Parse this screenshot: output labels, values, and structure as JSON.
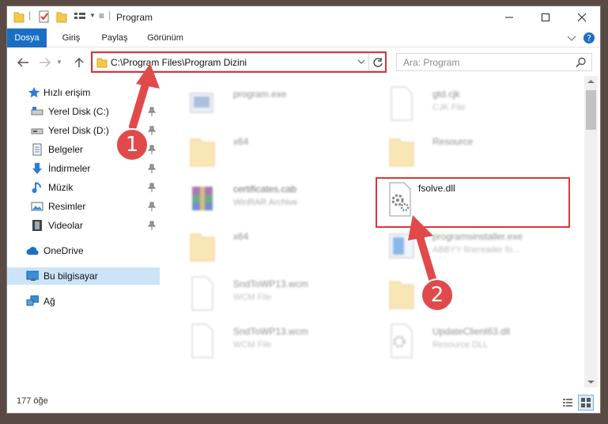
{
  "window": {
    "title": "Program"
  },
  "ribbon": {
    "tabs": [
      "Dosya",
      "Giriş",
      "Paylaş",
      "Görünüm"
    ]
  },
  "address": {
    "path": "C:\\Program Files\\Program Dizini"
  },
  "search": {
    "placeholder": "Ara: Program"
  },
  "sidebar": {
    "quick_access": "Hızlı erişim",
    "items": [
      "Yerel Disk (C:)",
      "Yerel Disk (D:)",
      "Belgeler",
      "İndirmeler",
      "Müzik",
      "Resimler",
      "Videolar"
    ],
    "onedrive": "OneDrive",
    "this_pc": "Bu bilgisayar",
    "network": "Ağ"
  },
  "files": [
    {
      "name": "program.exe",
      "type": "",
      "icon": "exe-icon"
    },
    {
      "name": "gtd.cjk",
      "type": "CJK File",
      "icon": "blank-file-icon"
    },
    {
      "name": "x64",
      "type": "",
      "icon": "folder-icon"
    },
    {
      "name": "Resource",
      "type": "",
      "icon": "folder-icon"
    },
    {
      "name": "certificates.cab",
      "type": "WinRAR Archive",
      "icon": "winrar-icon"
    },
    {
      "name": "fsolve.dll",
      "type": "",
      "icon": "dll-gear-icon"
    },
    {
      "name": "x64",
      "type": "",
      "icon": "folder-icon"
    },
    {
      "name": "programsinstaller.exe",
      "type": "ABBYY finereader fo...",
      "icon": "installer-icon"
    },
    {
      "name": "SndToWP13.wcm",
      "type": "WCM File",
      "icon": "blank-file-icon"
    },
    {
      "name": "x64",
      "type": "",
      "icon": "folder-icon"
    },
    {
      "name": "SndToWP13.wcm",
      "type": "WCM File",
      "icon": "blank-file-icon"
    },
    {
      "name": "UpdateClient63.dll",
      "type": "Resource DLL",
      "icon": "dll-gear-icon"
    }
  ],
  "status": {
    "count": "177 öğe"
  },
  "annotations": {
    "one": "1",
    "two": "2"
  },
  "colors": {
    "accent": "#1a6fc5",
    "highlight": "#d9363e"
  }
}
